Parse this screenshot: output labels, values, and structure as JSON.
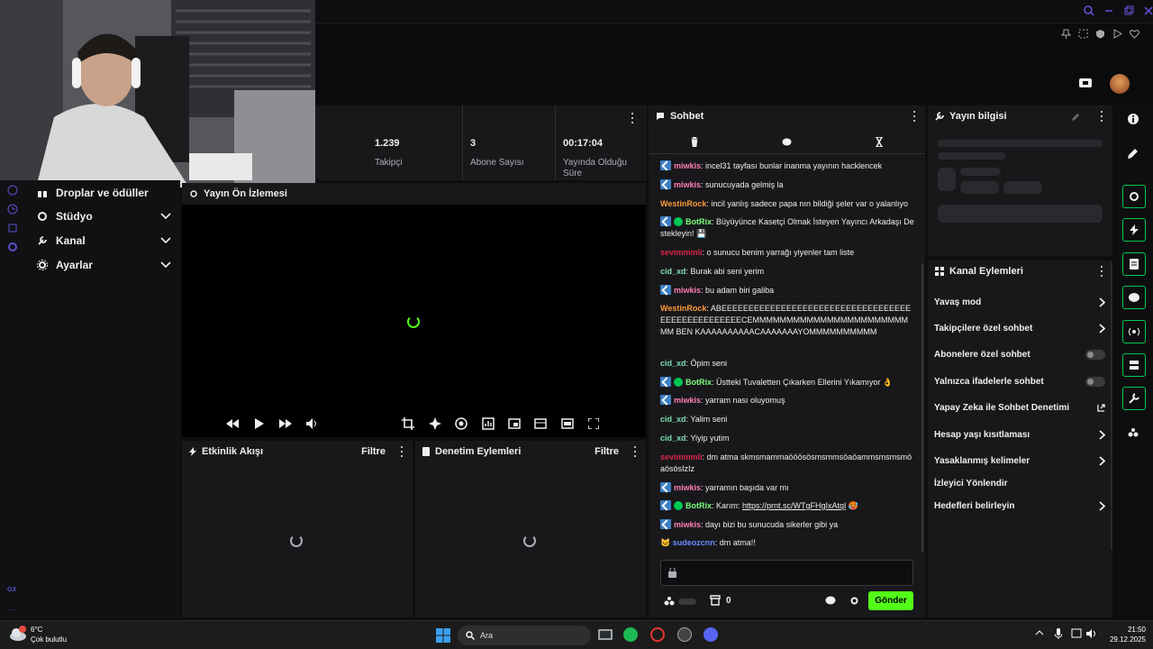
{
  "stats": [
    {
      "value": "1.239",
      "label": "Takipçi"
    },
    {
      "value": "3",
      "label": "Abone Sayısı"
    },
    {
      "value": "00:17:04",
      "label": "Yayında Olduğu Süre"
    }
  ],
  "nav": {
    "items": [
      {
        "label": "Droplar ve ödüller",
        "icon": "gift-icon"
      },
      {
        "label": "Stüdyo",
        "icon": "gear-icon"
      },
      {
        "label": "Kanal",
        "icon": "wrench-icon"
      },
      {
        "label": "Ayarlar",
        "icon": "gear-icon"
      }
    ],
    "badge": "GX"
  },
  "preview": {
    "title": "Yayın Ön İzlemesi"
  },
  "activity": {
    "title": "Etkinlik Akışı",
    "filter": "Filtre"
  },
  "moderation": {
    "title": "Denetim Eylemleri",
    "filter": "Filtre"
  },
  "chat": {
    "title": "Sohbet",
    "messages": [
      {
        "user": "miwkis",
        "color": "#ff7eb6",
        "badge": "blue",
        "text": "incel31 tayfası bunlar inanma yayının hacklencek"
      },
      {
        "user": "miwkis",
        "color": "#ff7eb6",
        "badge": "blue",
        "text": "sunucuyada gelmiş la"
      },
      {
        "user": "WestinRock",
        "color": "#ff9a3c",
        "badge": "",
        "text": "incil yanlış sadece papa nın bildiği şeler var o yalanlıyo"
      },
      {
        "user": "BotRix",
        "color": "#7cff7c",
        "badge": "blue+verified",
        "text": "Büyüyünce Kasetçi Olmak İsteyen Yayıncı Arkadaşı Destekleyin! 💾"
      },
      {
        "user": "sevimmmli",
        "color": "#d9264a",
        "badge": "",
        "text": "o sunucu benim yarrağı yiyenler tam liste"
      },
      {
        "user": "cid_xd",
        "color": "#7ddfb0",
        "badge": "",
        "text": "Burak abi seni yerim"
      },
      {
        "user": "miwkis",
        "color": "#ff7eb6",
        "badge": "blue",
        "text": "bu adam biri galiba"
      },
      {
        "user": "WestinRock",
        "color": "#ff9a3c",
        "badge": "",
        "text": "ABEEEEEEEEEEEEEEEEEEEEEEEEEEEEEEEEEEEEEEEEEEEEEEEEEECEMMMMMMMMMMMMMMMMMMMMMMMMM BEN KAAAAAAAAAACAAAAAAAYOMMMMMMMMMM"
      },
      {
        "user": "cid_xd",
        "color": "#7ddfb0",
        "badge": "",
        "text": "Öpim seni"
      },
      {
        "user": "BotRix",
        "color": "#7cff7c",
        "badge": "blue+verified",
        "text": "Üstteki Tuvaletten Çıkarken Ellerini Yıkamıyor 👌"
      },
      {
        "user": "miwkis",
        "color": "#ff7eb6",
        "badge": "blue",
        "text": "yarram nası oluyomuş"
      },
      {
        "user": "cid_xd",
        "color": "#7ddfb0",
        "badge": "",
        "text": "Yalim seni"
      },
      {
        "user": "cid_xd",
        "color": "#7ddfb0",
        "badge": "",
        "text": "Yiyip yutim"
      },
      {
        "user": "sevimmmli",
        "color": "#d9264a",
        "badge": "",
        "text": "dm atma skmsmammaööösösmsmmsöaöammsmsmsmöaösösIzIz"
      },
      {
        "user": "miwkis",
        "color": "#ff7eb6",
        "badge": "blue",
        "text": "yarramın başıda var mı"
      },
      {
        "user": "BotRix",
        "color": "#7cff7c",
        "badge": "blue+verified",
        "text": "Karım: ",
        "link": "https://prnt.sc/WTgFHgIxAtql",
        "suffix": " 🥵"
      },
      {
        "user": "miwkis",
        "color": "#ff7eb6",
        "badge": "blue",
        "text": "dayı bizi bu sunucuda sikerler gibi ya"
      },
      {
        "user": "sudeozcnn",
        "color": "#6a8cff",
        "badge": "cat",
        "text": "dm atma!!"
      }
    ],
    "send_label": "Gönder",
    "points": "0"
  },
  "stream_info": {
    "title": "Yayın bilgisi"
  },
  "channel_actions": {
    "title": "Kanal Eylemleri",
    "items": [
      {
        "label": "Yavaş mod",
        "control": "chevron"
      },
      {
        "label": "Takipçilere özel sohbet",
        "control": "chevron"
      },
      {
        "label": "Abonelere özel sohbet",
        "control": "toggle"
      },
      {
        "label": "Yalnızca ifadelerle sohbet",
        "control": "toggle"
      },
      {
        "label": "Yapay Zeka ile Sohbet Denetimi",
        "control": "external"
      },
      {
        "label": "Hesap yaşı kısıtlaması",
        "control": "chevron"
      },
      {
        "label": "Yasaklanmış kelimeler",
        "control": "chevron"
      },
      {
        "label": "İzleyici Yönlendir",
        "control": "none"
      },
      {
        "label": "Hedefleri belirleyin",
        "control": "chevron"
      }
    ]
  },
  "taskbar": {
    "weather_temp": "6°C",
    "weather_desc": "Çok bulutlu",
    "search_placeholder": "Ara",
    "time": "21:50",
    "date": "29.12.2025"
  },
  "colors": {
    "accent": "#53fc18",
    "bg": "#0e0e10",
    "panel": "#18181b",
    "highlight_border": "#00c853"
  }
}
